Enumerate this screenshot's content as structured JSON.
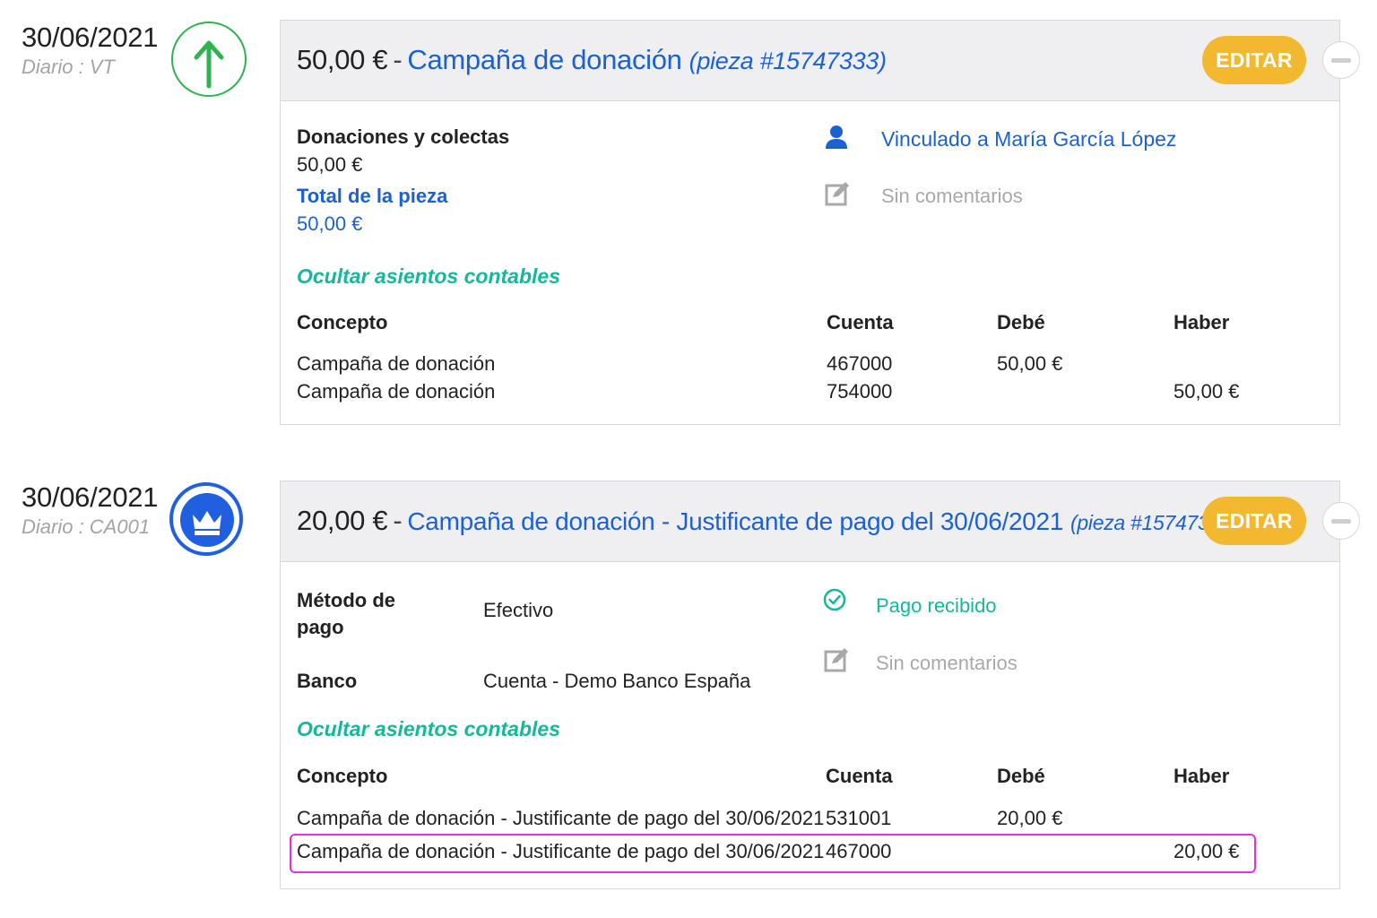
{
  "entries": [
    {
      "date": "30/06/2021",
      "journal": "Diario : VT",
      "badge_icon": "arrow-up-icon",
      "badge_color": "#2eb350",
      "amount": "50,00 €",
      "separator": "-",
      "title": "Campaña de donación",
      "ref": "(pieza #15747333)",
      "edit_label": "EDITAR",
      "category": "Donaciones y colectas",
      "category_amount": "50,00 €",
      "total_label": "Total de la pieza",
      "total_amount": "50,00 €",
      "linked_text": "Vinculado a María García López",
      "comments": "Sin comentarios",
      "toggle_label": "Ocultar asientos contables",
      "table": {
        "headers": [
          "Concepto",
          "Cuenta",
          "Debé",
          "Haber"
        ],
        "rows": [
          [
            "Campaña de donación",
            "467000",
            "50,00 €",
            ""
          ],
          [
            "Campaña de donación",
            "754000",
            "",
            "50,00 €"
          ]
        ]
      }
    },
    {
      "date": "30/06/2021",
      "journal": "Diario : CA001",
      "badge_icon": "crown-icon",
      "badge_color": "#1f5fe0",
      "amount": "20,00 €",
      "separator": "-",
      "title": "Campaña de donación - Justificante de pago del 30/06/2021",
      "ref": "(pieza #15747337)",
      "edit_label": "EDITAR",
      "payment_method_label": "Método de pago",
      "payment_method_value": "Efectivo",
      "bank_label": "Banco",
      "bank_value": "Cuenta - Demo Banco España",
      "status_text": "Pago recibido",
      "comments": "Sin comentarios",
      "toggle_label": "Ocultar asientos contables",
      "table": {
        "headers": [
          "Concepto",
          "Cuenta",
          "Debé",
          "Haber"
        ],
        "rows": [
          [
            "Campaña de donación - Justificante de pago del 30/06/2021",
            "531001",
            "20,00 €",
            ""
          ],
          [
            "Campaña de donación - Justificante de pago del 30/06/2021",
            "467000",
            "",
            "20,00 €"
          ]
        ],
        "highlighted_row": 1
      }
    }
  ],
  "colors": {
    "accent_blue": "#1b62d0",
    "teal": "#14b89a",
    "edit_button": "#f2b82f",
    "highlight": "#e62fe2"
  }
}
